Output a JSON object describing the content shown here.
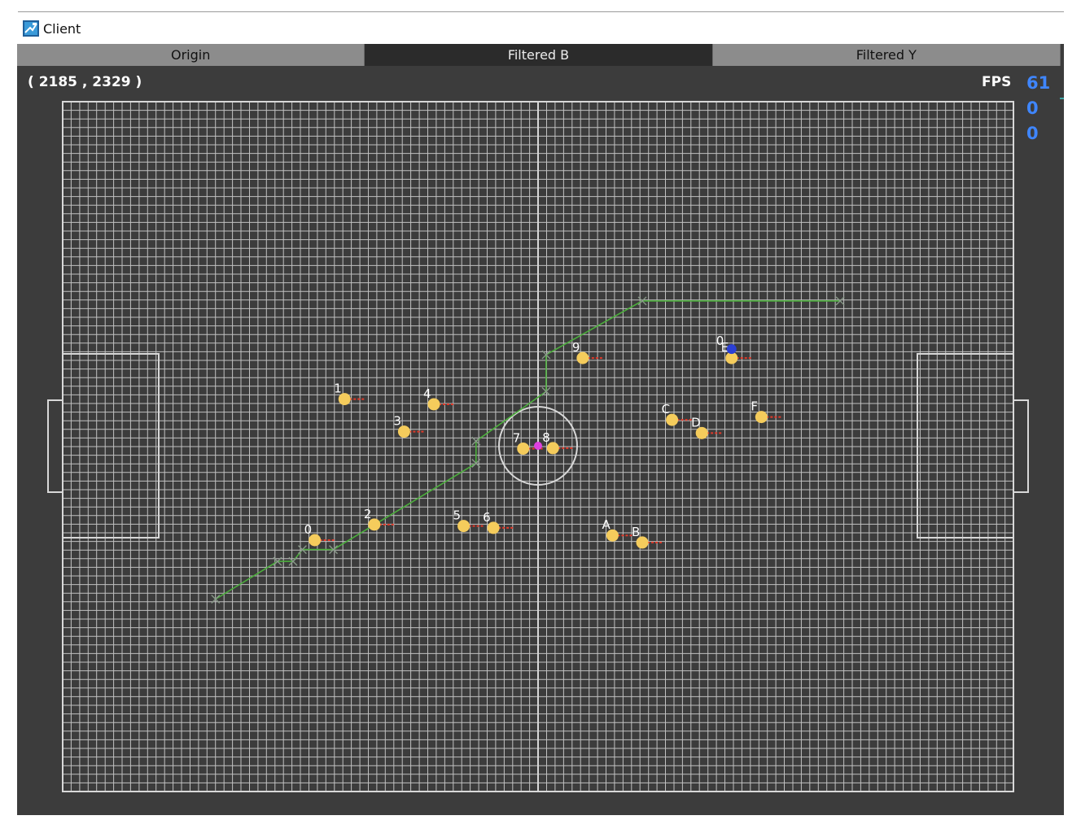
{
  "window": {
    "title": "Client"
  },
  "tabs": [
    {
      "label": "Origin",
      "active": false
    },
    {
      "label": "Filtered B",
      "active": true
    },
    {
      "label": "Filtered Y",
      "active": false
    }
  ],
  "coordinate_readout": "( 2185 , 2329 )",
  "fps": {
    "label": "FPS",
    "value": "61",
    "line2": "0",
    "line3": "0"
  },
  "colors": {
    "background": "#3c3c3c",
    "grid": "#d8d8d8",
    "player": "#f5cc5c",
    "direction": "#e23a2a",
    "path": "#4caf3c",
    "ball": "#e040e0",
    "selected": "#2b3fd4",
    "fps_text": "#3f86ff"
  },
  "players": [
    {
      "label": "0",
      "x": -3.6,
      "y": -2.0
    },
    {
      "label": "1",
      "x": -3.12,
      "y": 0.99
    },
    {
      "label": "2",
      "x": -2.64,
      "y": -1.67
    },
    {
      "label": "3",
      "x": -2.16,
      "y": 0.3
    },
    {
      "label": "4",
      "x": -1.68,
      "y": 0.88
    },
    {
      "label": "5",
      "x": -1.2,
      "y": -1.7
    },
    {
      "label": "6",
      "x": -0.72,
      "y": -1.74
    },
    {
      "label": "7",
      "x": -0.24,
      "y": -0.06
    },
    {
      "label": "8",
      "x": 0.24,
      "y": -0.05
    },
    {
      "label": "9",
      "x": 0.72,
      "y": 1.86
    },
    {
      "label": "A",
      "x": 1.2,
      "y": -1.9
    },
    {
      "label": "B",
      "x": 1.68,
      "y": -2.05
    },
    {
      "label": "C",
      "x": 2.16,
      "y": 0.55
    },
    {
      "label": "D",
      "x": 2.64,
      "y": 0.27
    },
    {
      "label": "E",
      "x": 3.12,
      "y": 1.86
    },
    {
      "label": "F",
      "x": 3.6,
      "y": 0.61
    }
  ],
  "ball": {
    "x": 0.0,
    "y": 0.0
  },
  "selected_marker": {
    "label": "0",
    "x": 3.12,
    "y": 2.05
  },
  "path": [
    {
      "x": -5.2,
      "y": -3.25
    },
    {
      "x": -4.2,
      "y": -2.45
    },
    {
      "x": -3.95,
      "y": -2.45
    },
    {
      "x": -3.8,
      "y": -2.2
    },
    {
      "x": -3.3,
      "y": -2.2
    },
    {
      "x": -1.0,
      "y": -0.37
    },
    {
      "x": -1.0,
      "y": 0.1
    },
    {
      "x": 0.13,
      "y": 1.15
    },
    {
      "x": 0.13,
      "y": 1.93
    },
    {
      "x": 1.68,
      "y": 3.07
    },
    {
      "x": 4.87,
      "y": 3.07
    }
  ]
}
